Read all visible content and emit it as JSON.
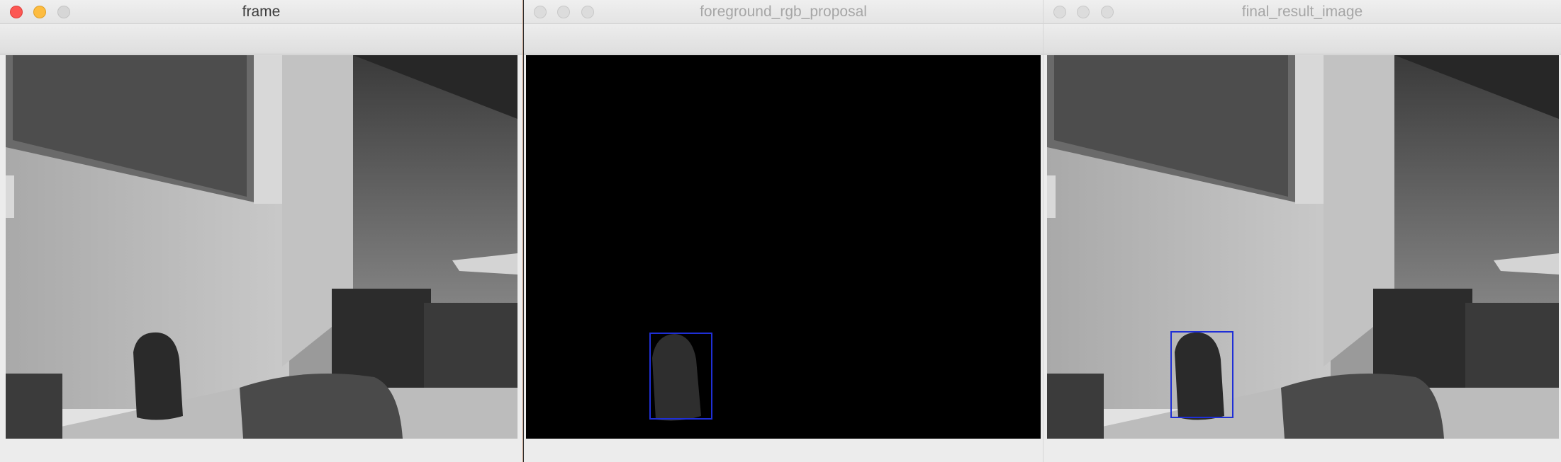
{
  "windows": [
    {
      "title": "frame",
      "state": "active"
    },
    {
      "title": "foreground_rgb_proposal",
      "state": "inactive"
    },
    {
      "title": "final_result_image",
      "state": "inactive"
    }
  ],
  "colors": {
    "bounding_box": "#1f2fd6",
    "traffic_close": "#fc5753",
    "traffic_minimize": "#fdbc40"
  }
}
